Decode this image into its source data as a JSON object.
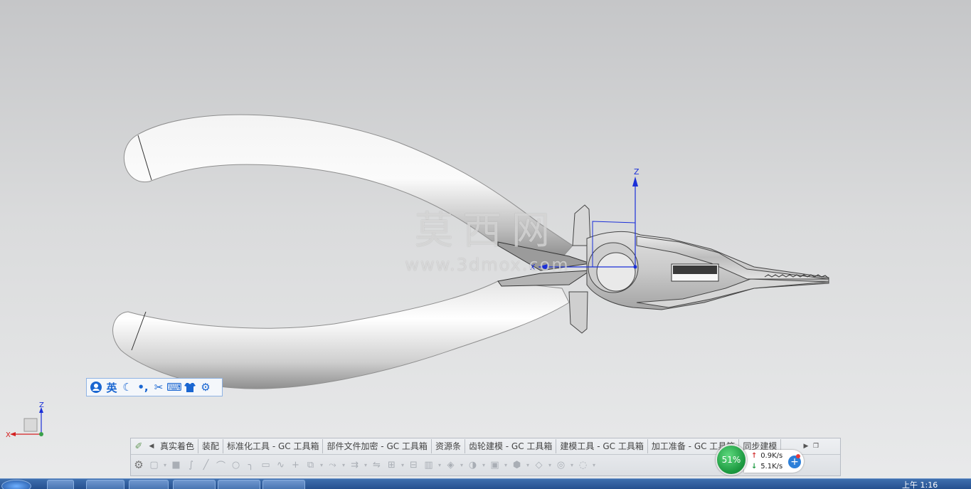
{
  "viewport": {
    "axis_labels": {
      "z": "Z",
      "x": "X"
    },
    "watermark": {
      "title": "莫西网",
      "url": "www.3dmox.com"
    }
  },
  "ime_bar": {
    "items": [
      {
        "name": "user-icon",
        "glyph": "●"
      },
      {
        "name": "language-toggle",
        "glyph": "英"
      },
      {
        "name": "moon-icon",
        "glyph": "☾"
      },
      {
        "name": "punctuation-icon",
        "glyph": "•,"
      },
      {
        "name": "scissors-icon",
        "glyph": "✂"
      },
      {
        "name": "keyboard-icon",
        "glyph": "⌨"
      },
      {
        "name": "shirt-icon",
        "glyph": "▼"
      },
      {
        "name": "settings-icon",
        "glyph": "⚙"
      }
    ]
  },
  "triad": {
    "z": "Z",
    "x": "X"
  },
  "toolbar": {
    "tabs": [
      "真实着色",
      "装配",
      "标准化工具 - GC 工具箱",
      "部件文件加密 - GC 工具箱",
      "资源条",
      "齿轮建模 - GC 工具箱",
      "建模工具 - GC 工具箱",
      "加工准备 - GC 工具箱",
      "同步建模"
    ]
  },
  "network": {
    "percent": "51%",
    "upload": "0.9K/s",
    "download": "5.1K/s"
  },
  "taskbar": {
    "clock": "上午 1:16"
  },
  "colors": {
    "axis": "#1a2fd8",
    "pliers_light": "#f5f5f5",
    "pliers_shadow": "#9a9a9a",
    "net_green": "#1d9a41"
  }
}
